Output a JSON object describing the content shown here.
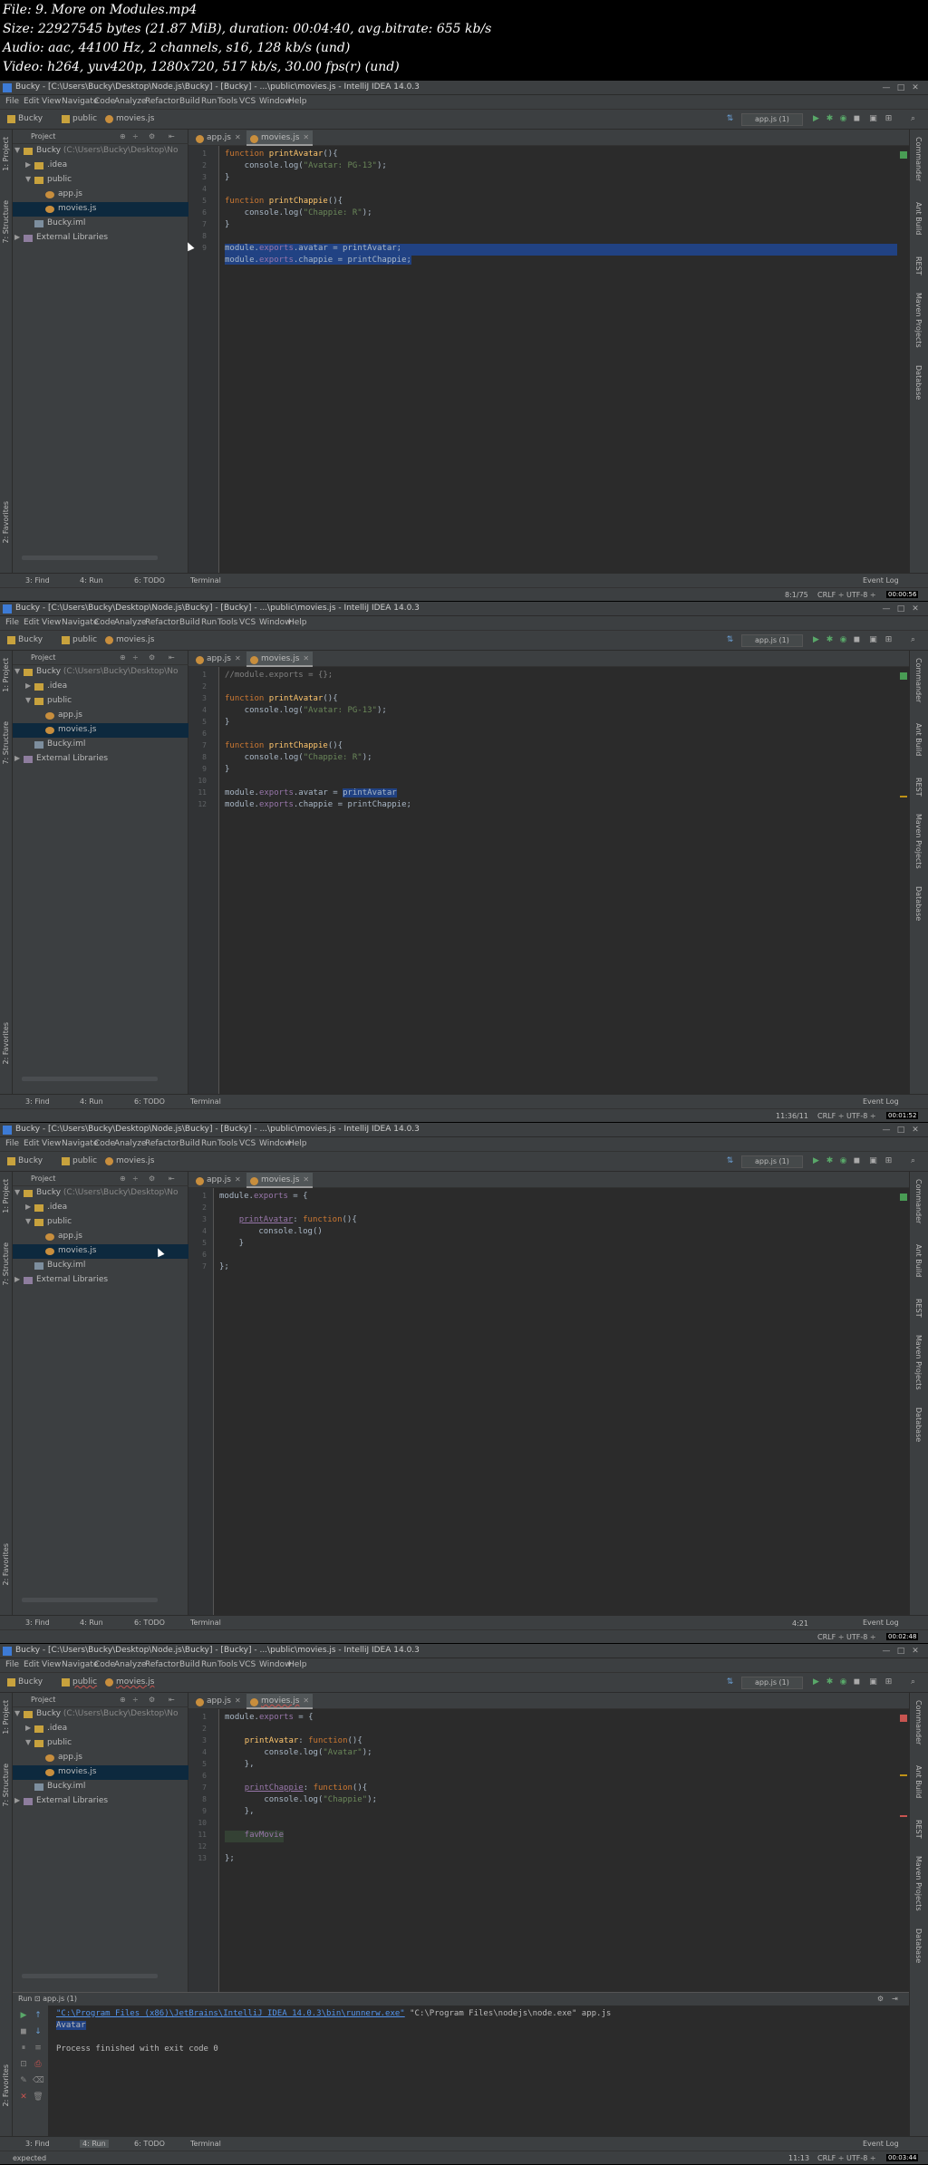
{
  "meta": {
    "lines": [
      "File: 9. More on Modules.mp4",
      "Size: 22927545 bytes (21.87 MiB), duration: 00:04:40, avg.bitrate: 655 kb/s",
      "Audio: aac, 44100 Hz, 2 channels, s16, 128 kb/s (und)",
      "Video: h264, yuv420p, 1280x720, 517 kb/s, 30.00 fps(r) (und)"
    ]
  },
  "window": {
    "title": "Bucky - [C:\\Users\\Bucky\\Desktop\\Node.js\\Bucky] - [Bucky] - ...\\public\\movies.js - IntelliJ IDEA 14.0.3",
    "min": "—",
    "max": "□",
    "close": "✕"
  },
  "menu": [
    "File",
    "Edit",
    "View",
    "Navigate",
    "Code",
    "Analyze",
    "Refactor",
    "Build",
    "Run",
    "Tools",
    "VCS",
    "Window",
    "Help"
  ],
  "breadcrumbs": [
    "Bucky",
    "public",
    "movies.js"
  ],
  "run_config": "app.js (1)",
  "project_panel": {
    "label": "Project",
    "root_name": "Bucky",
    "root_path": "(C:\\Users\\Bucky\\Desktop\\No",
    "idea": ".idea",
    "public": "public",
    "app_js": "app.js",
    "movies_js": "movies.js",
    "iml": "Bucky.iml",
    "libs": "External Libraries"
  },
  "tabs": [
    "app.js",
    "movies.js"
  ],
  "left_strip": {
    "project": "1: Project",
    "structure": "7: Structure",
    "favorites": "2: Favorites"
  },
  "right_strip": [
    "Commander",
    "Ant Build",
    "REST",
    "Maven Projects",
    "Database"
  ],
  "bottom_tools": [
    "3: Find",
    "4: Run",
    "6: TODO",
    "Terminal"
  ],
  "event_log": "Event Log",
  "frames": [
    {
      "status_pos": "8:1/75",
      "status_rest": "CRLF ÷  UTF-8 ÷",
      "stamp": "00:00:56",
      "line_numbers": [
        "1",
        "2",
        "3",
        "4",
        "5",
        "6",
        "7",
        "8",
        "9"
      ],
      "code": {
        "l1a": "function ",
        "l1b": "printAvatar",
        "l1c": "(){",
        "l2a": "    console.log(",
        "l2b": "\"Avatar: PG-13\"",
        "l2c": ");",
        "l3": "}",
        "l5a": "function ",
        "l5b": "printChappie",
        "l5c": "(){",
        "l6a": "    console.log(",
        "l6b": "\"Chappie: R\"",
        "l6c": ");",
        "l7": "}",
        "l9a": "module.",
        "l9b": "exports",
        "l9c": ".avatar = printAvatar;",
        "l10a": "module.",
        "l10b": "exports",
        "l10c": ".chappie = printChappie;"
      }
    },
    {
      "status_pos": "11:36/11",
      "status_rest": "CRLF ÷  UTF-8 ÷",
      "stamp": "00:01:52",
      "line_numbers": [
        "1",
        "2",
        "3",
        "4",
        "5",
        "6",
        "7",
        "8",
        "9",
        "10",
        "11",
        "12"
      ],
      "code": {
        "l1": "//module.exports = {};",
        "l3a": "function ",
        "l3b": "printAvatar",
        "l3c": "(){",
        "l4a": "    console.log(",
        "l4b": "\"Avatar: PG-13\"",
        "l4c": ");",
        "l5": "}",
        "l7a": "function ",
        "l7b": "printChappie",
        "l7c": "(){",
        "l8a": "    console.log(",
        "l8b": "\"Chappie: R\"",
        "l8c": ");",
        "l9": "}",
        "l11a": "module.",
        "l11b": "exports",
        "l11c": ".avatar = ",
        "l11d": "printAvatar",
        "l12a": "module.",
        "l12b": "exports",
        "l12c": ".chappie = printChappie;"
      }
    },
    {
      "status_pos": "4:21",
      "status_rest": "CRLF ÷  UTF-8 ÷",
      "stamp": "00:02:48",
      "line_numbers": [
        "1",
        "2",
        "3",
        "4",
        "5",
        "6",
        "7"
      ],
      "code": {
        "l1a": "module.",
        "l1b": "exports",
        "l1c": " = {",
        "l3a": "    ",
        "l3b": "printAvatar",
        "l3c": ": ",
        "l3d": "function",
        "l3e": "(){",
        "l4": "        console.log()",
        "l5": "    }",
        "l7": "};"
      }
    },
    {
      "status_pos": "11:13",
      "status_rest": "CRLF ÷  UTF-8 ÷",
      "stamp": "00:03:44",
      "status_left": "expected",
      "line_numbers": [
        "1",
        "2",
        "3",
        "4",
        "5",
        "6",
        "7",
        "8",
        "9",
        "10",
        "11",
        "12",
        "13"
      ],
      "code": {
        "l1a": "module.",
        "l1b": "exports",
        "l1c": " = {",
        "l3a": "    ",
        "l3b": "printAvatar",
        "l3c": ": ",
        "l3d": "function",
        "l3e": "(){",
        "l4a": "        console.log(",
        "l4b": "\"Avatar\"",
        "l4c": ");",
        "l5": "    },",
        "l7a": "    ",
        "l7b": "printChappie",
        "l7c": ": ",
        "l7d": "function",
        "l7e": "(){",
        "l8a": "        console.log(",
        "l8b": "\"Chappie\"",
        "l8c": ");",
        "l9": "    },",
        "l11": "    favMovie",
        "l13": "};"
      },
      "run": {
        "header": "Run  ⊡ app.js (1)",
        "cmd_a": "\"C:\\Program Files (x86)\\JetBrains\\IntelliJ IDEA 14.0.3\\bin\\runnerw.exe\"",
        "cmd_b": " \"C:\\Program Files\\nodejs\\node.exe\" app.js",
        "out": "Avatar",
        "done": "Process finished with exit code 0"
      }
    }
  ]
}
